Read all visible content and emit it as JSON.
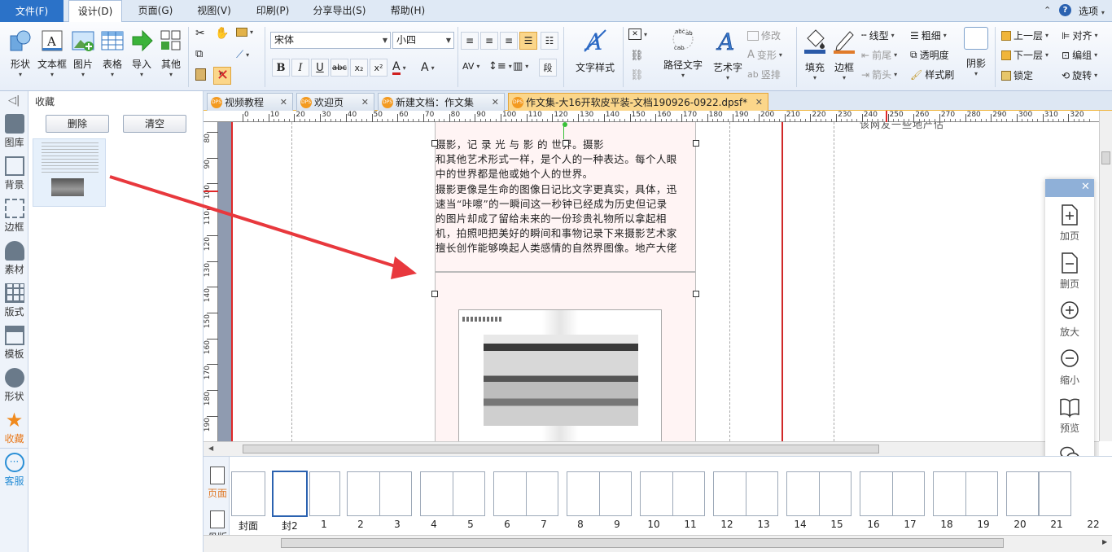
{
  "menubar": {
    "file": "文件(F)",
    "design": "设计(D)",
    "page": "页面(G)",
    "view": "视图(V)",
    "print": "印刷(P)",
    "share": "分享导出(S)",
    "help": "帮助(H)",
    "options": "选项"
  },
  "ribbon": {
    "shape": "形状",
    "textbox": "文本框",
    "image": "图片",
    "table": "表格",
    "import": "导入",
    "other": "其他",
    "font": "宋体",
    "size": "小四",
    "art_text_style": "文字样式",
    "path_text": "路径文字",
    "art_text": "艺术字",
    "modify": "修改",
    "deform": "变形",
    "vertical": "竖排",
    "line_type": "线型",
    "thickness": "粗细",
    "arrow_front": "前尾",
    "arrow_head": "箭头",
    "transparency": "透明度",
    "style_brush": "样式刷",
    "fill": "填充",
    "border": "边框",
    "shadow": "阴影",
    "up_layer": "上一层",
    "down_layer": "下一层",
    "lock": "锁定",
    "align": "对齐",
    "group": "编组",
    "rotate": "旋转"
  },
  "leftbar": {
    "items": [
      "图库",
      "背景",
      "边框",
      "素材",
      "版式",
      "模板",
      "形状",
      "收藏",
      "客服"
    ]
  },
  "favpanel": {
    "title": "收藏",
    "delete": "删除",
    "clear": "清空"
  },
  "tabs": [
    {
      "label": "视频教程"
    },
    {
      "label": "欢迎页"
    },
    {
      "label": "新建文档：作文集"
    },
    {
      "label": "作文集-大16开软皮平装-文档190926-0922.dpsf*"
    }
  ],
  "ruler_h": [
    "0",
    "10",
    "20",
    "30",
    "40",
    "50",
    "60",
    "70",
    "80",
    "90",
    "100",
    "110",
    "120",
    "130",
    "140",
    "150",
    "160",
    "170",
    "180",
    "190",
    "200",
    "210",
    "220",
    "230",
    "240",
    "250",
    "260",
    "270",
    "280",
    "290",
    "300",
    "310",
    "320"
  ],
  "ruler_v": [
    "80",
    "90",
    "100",
    "110",
    "120",
    "130",
    "140",
    "150",
    "160",
    "170",
    "180",
    "190"
  ],
  "document": {
    "lines": [
      "摄影，记 录 光 与 影 的 世界。摄影",
      "和其他艺术形式一样，是个人的一种表达。每个人眼",
      "中的世界都是他或她个人的世界。",
      "摄影更像是生命的图像日记比文字更真实，具体，迅",
      "速当“咔嚓”的一瞬间这一秒钟已经成为历史但记录",
      "的图片却成了留给未来的一份珍贵礼物所以拿起相",
      "机，拍照吧把美好的瞬间和事物记录下来摄影艺术家",
      "擅长创作能够唤起人类感情的自然界图像。地产大佬"
    ],
    "right_page_partial": "该网友一些地产估"
  },
  "floatpanel": {
    "add": "加页",
    "del": "删页",
    "zoom_in": "放大",
    "zoom_out": "缩小",
    "preview": "预览",
    "share": "分享"
  },
  "thumbs": {
    "page_tab": "页面",
    "master_tab": "母版",
    "labels": [
      "封面",
      "封2",
      "1",
      "2",
      "3",
      "4",
      "5",
      "6",
      "7",
      "8",
      "9",
      "10",
      "11",
      "12",
      "13",
      "14",
      "15",
      "16",
      "17",
      "18",
      "19",
      "20",
      "21",
      "22"
    ]
  },
  "colors": {
    "accent": "#2b72c8",
    "arrow": "#e8383d",
    "active_tab": "#fbd68a"
  }
}
